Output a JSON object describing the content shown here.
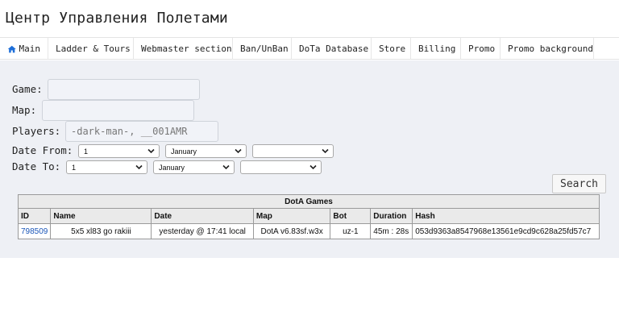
{
  "site": {
    "title": "Центр Управления Полетами"
  },
  "nav": {
    "items": [
      {
        "label": "Main",
        "icon": "home-icon"
      },
      {
        "label": "Ladder & Tours"
      },
      {
        "label": "Webmaster section"
      },
      {
        "label": "Ban/UnBan"
      },
      {
        "label": "DoTa Database"
      },
      {
        "label": "Store"
      },
      {
        "label": "Billing"
      },
      {
        "label": "Promo"
      },
      {
        "label": "Promo background"
      }
    ],
    "icon_color": "#1e6fd9"
  },
  "form": {
    "game": {
      "label": "Game:",
      "value": ""
    },
    "map": {
      "label": "Map:",
      "value": ""
    },
    "players": {
      "label": "Players:",
      "placeholder": "-dark-man-, __001AMR"
    },
    "date_from": {
      "label": "Date From:",
      "day": "1",
      "month": "January",
      "year": ""
    },
    "date_to": {
      "label": "Date To:",
      "day": "1",
      "month": "January",
      "year": ""
    },
    "search_label": "Search"
  },
  "table": {
    "caption": "DotA Games",
    "columns": [
      "ID",
      "Name",
      "Date",
      "Map",
      "Bot",
      "Duration",
      "Hash"
    ],
    "rows": [
      {
        "id": "798509",
        "name": "5x5 xl83 go rakiii",
        "date": "yesterday @ 17:41 local",
        "map": "DotA v6.83sf.w3x",
        "bot": "uz-1",
        "duration": "45m : 28s",
        "hash": "053d9363a8547968e13561e9cd9c628a25fd57c7"
      }
    ]
  }
}
